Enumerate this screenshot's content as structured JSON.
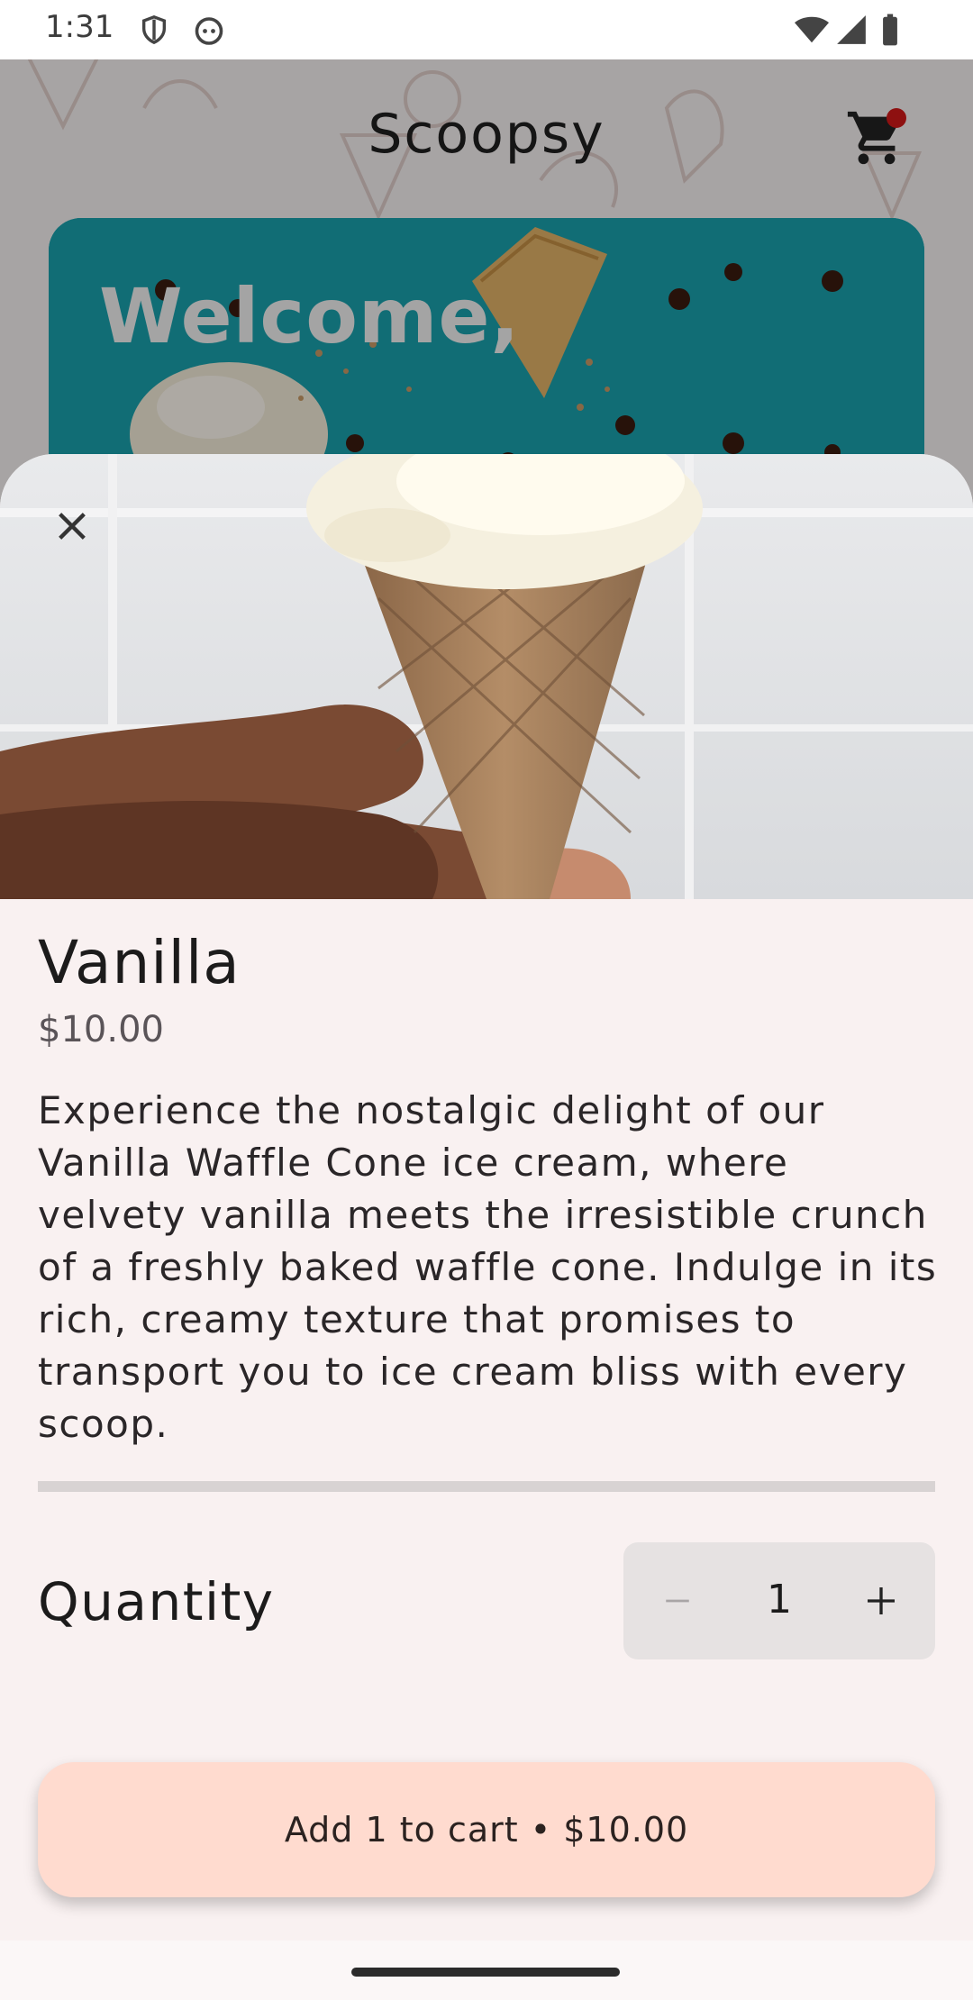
{
  "status_bar": {
    "time": "1:31",
    "icons": [
      "shield-icon",
      "android-face-icon",
      "wifi-icon",
      "signal-icon",
      "battery-icon"
    ]
  },
  "app": {
    "title": "Scoopsy",
    "cart_icon": "cart-icon",
    "cart_badge_color": "#d21919",
    "welcome_text": "Welcome,"
  },
  "sheet": {
    "close_icon": "close-icon",
    "product": {
      "name": "Vanilla",
      "price": "$10.00",
      "description": "Experience the nostalgic delight of our Vanilla Waffle Cone ice cream, where velvety vanilla meets the irresistible crunch of a freshly baked waffle cone. Indulge in its rich, creamy texture that promises to transport you to ice cream bliss with every scoop."
    },
    "quantity": {
      "label": "Quantity",
      "value": "1",
      "minus_icon": "minus-icon",
      "plus_icon": "plus-icon"
    },
    "add_to_cart_label": "Add 1 to cart • $10.00"
  },
  "colors": {
    "accent_button": "#ffdbcf",
    "sheet_background": "#f9f1f1",
    "welcome_card": "#1aa1ad"
  }
}
